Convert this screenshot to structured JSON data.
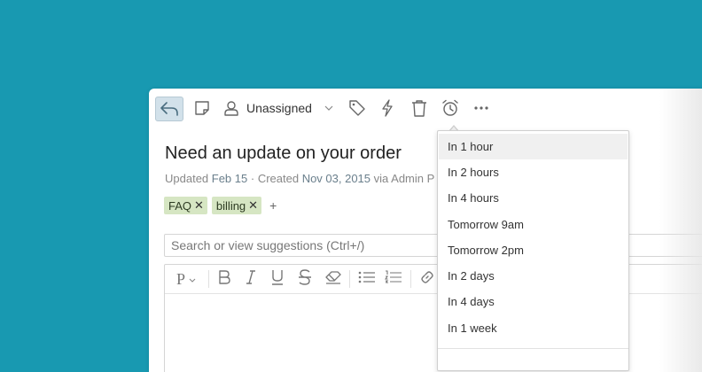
{
  "toolbar": {
    "assignee_label": "Unassigned"
  },
  "ticket": {
    "title": "Need an update on your order",
    "meta": {
      "updated_prefix": "Updated ",
      "updated_value": "Feb 15",
      "separator": " · ",
      "created_prefix": "Created ",
      "created_value": "Nov 03, 2015",
      "via_text": " via Admin P"
    },
    "tags": [
      {
        "label": "FAQ"
      },
      {
        "label": "billing"
      }
    ],
    "tag_remove_glyph": "✕",
    "add_tag_glyph": "+"
  },
  "reply": {
    "search_placeholder": "Search or view suggestions (Ctrl+/)"
  },
  "editor": {
    "format_label": "P"
  },
  "snooze_menu": {
    "items": [
      {
        "label": "In 1 hour"
      },
      {
        "label": "In 2 hours"
      },
      {
        "label": "In 4 hours"
      },
      {
        "label": "Tomorrow 9am"
      },
      {
        "label": "Tomorrow 2pm"
      },
      {
        "label": "In 2 days"
      },
      {
        "label": "In 4 days"
      },
      {
        "label": "In 1 week"
      }
    ],
    "highlighted_index": 0
  },
  "colors": {
    "background": "#1899b1",
    "tag_bg": "#d6e6c3",
    "reply_active_bg": "#d2e1ea"
  },
  "icons": [
    "reply-icon",
    "note-icon",
    "user-icon",
    "chevron-down-icon",
    "tag-icon",
    "bolt-icon",
    "trash-icon",
    "alarm-clock-icon",
    "more-icon",
    "bold-icon",
    "italic-icon",
    "underline-icon",
    "strikethrough-icon",
    "eraser-icon",
    "bullet-list-icon",
    "numbered-list-icon",
    "link-icon"
  ]
}
